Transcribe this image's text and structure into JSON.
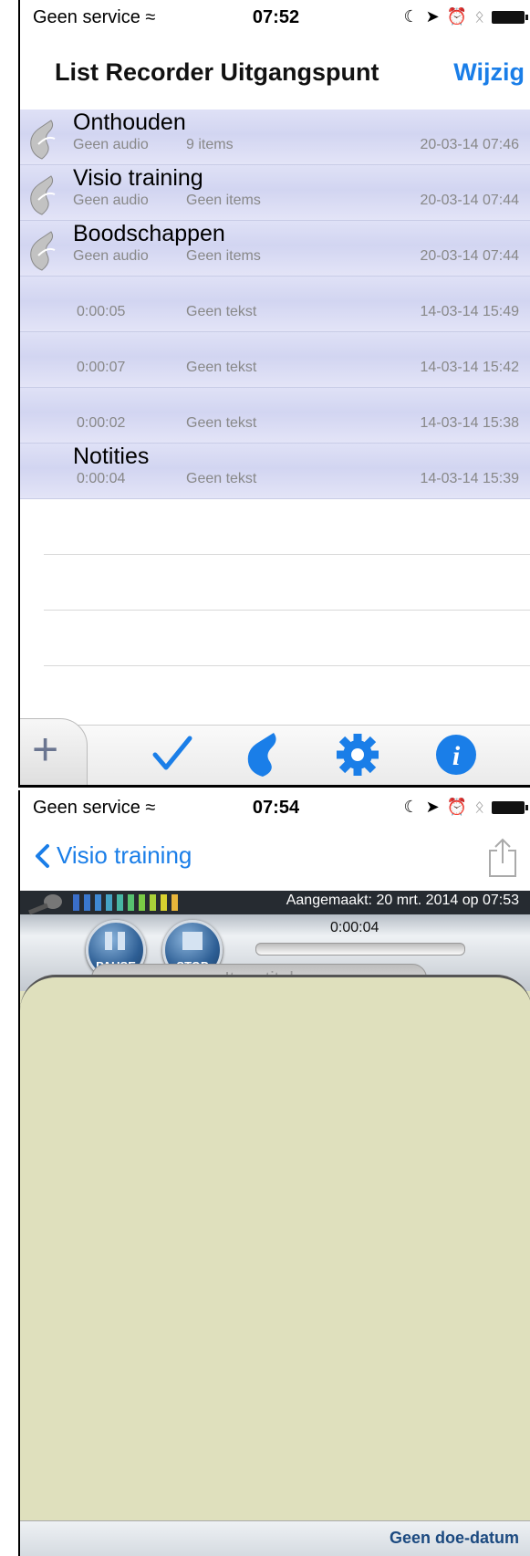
{
  "screen1": {
    "status": {
      "carrier": "Geen service",
      "time": "07:52"
    },
    "nav": {
      "title": "List Recorder Uitgangspunt",
      "edit_label": "Wijzig"
    },
    "folders": [
      {
        "title": "Onthouden",
        "audio": "Geen audio",
        "items": "9 items",
        "date": "20-03-14 07:46"
      },
      {
        "title": "Visio training",
        "audio": "Geen audio",
        "items": "Geen items",
        "date": "20-03-14 07:44"
      },
      {
        "title": "Boodschappen",
        "audio": "Geen audio",
        "items": "Geen items",
        "date": "20-03-14 07:44"
      }
    ],
    "recordings": [
      {
        "title": "",
        "duration": "0:00:05",
        "text": "Geen tekst",
        "date": "14-03-14 15:49"
      },
      {
        "title": "",
        "duration": "0:00:07",
        "text": "Geen tekst",
        "date": "14-03-14 15:42"
      },
      {
        "title": "",
        "duration": "0:00:02",
        "text": "Geen tekst",
        "date": "14-03-14 15:38"
      },
      {
        "title": "Notities",
        "duration": "0:00:04",
        "text": "Geen tekst",
        "date": "14-03-14 15:39"
      }
    ],
    "toolbar": {
      "add": "add-icon",
      "check": "checkmark-icon",
      "folder": "folder-icon",
      "settings": "gear-icon",
      "info": "info-icon"
    }
  },
  "screen2": {
    "status": {
      "carrier": "Geen service",
      "time": "07:54"
    },
    "nav": {
      "back_label": "Visio training",
      "share": "share-icon"
    },
    "recorder": {
      "created": "Aangemaakt: 20 mrt. 2014 op 07:53",
      "pause_label": "PAUSE",
      "stop_label": "STOP",
      "timer": "0:00:04",
      "title_placeholder": "Item titel",
      "meter_colors": [
        "#3a6ec9",
        "#3a78cf",
        "#3f89d3",
        "#45a3c4",
        "#47b6a4",
        "#57c26f",
        "#7acb45",
        "#a9d039",
        "#d8d12f",
        "#e8b53a"
      ]
    },
    "footer": {
      "due_label": "Geen doe-datum"
    }
  }
}
